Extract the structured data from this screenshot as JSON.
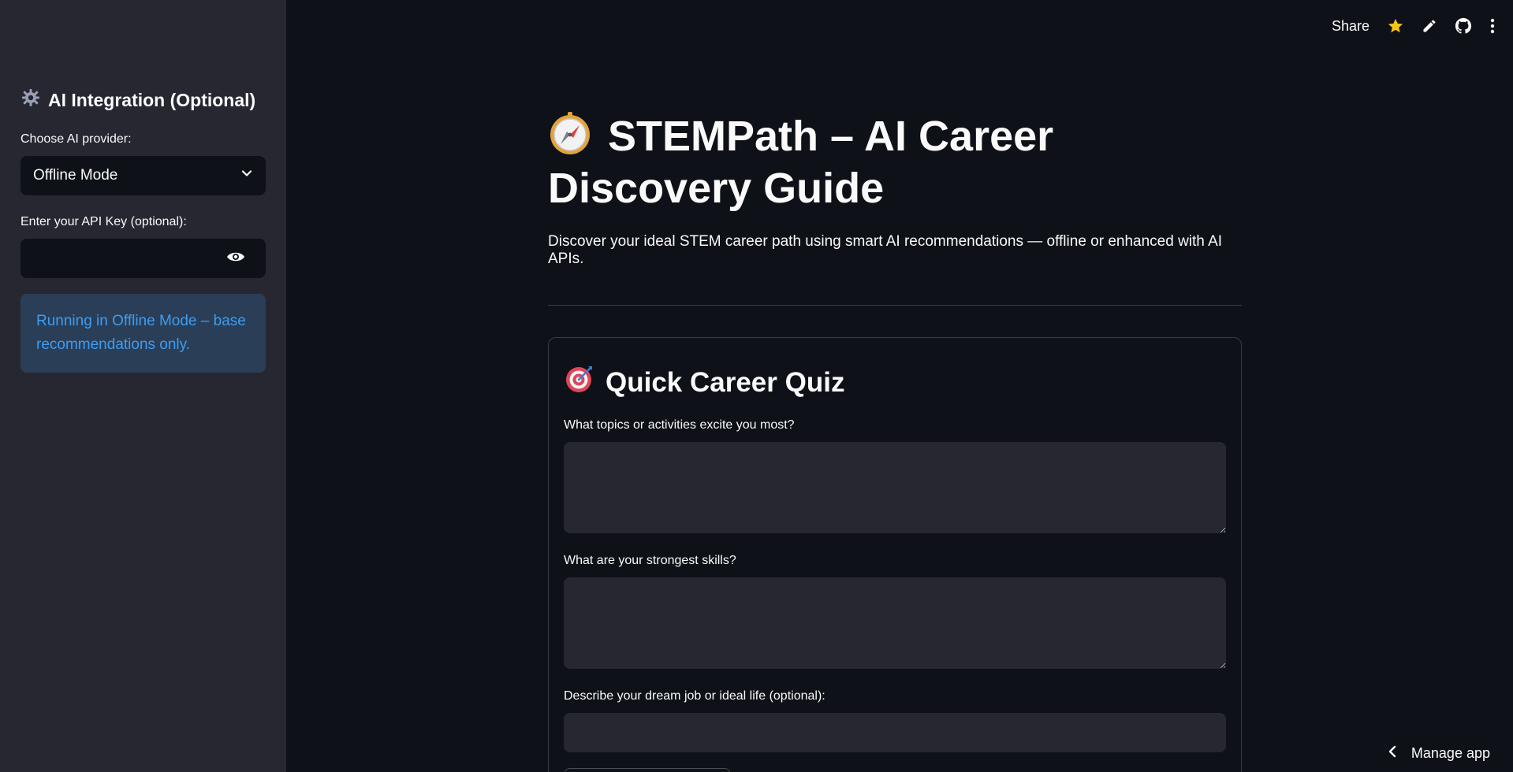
{
  "toolbar": {
    "share_label": "Share",
    "icons": [
      "star-icon",
      "edit-icon",
      "github-icon",
      "more-vert-icon"
    ],
    "star_color": "#f5c518"
  },
  "sidebar": {
    "title": "AI Integration (Optional)",
    "title_icon": "gear-icon",
    "provider_label": "Choose AI provider:",
    "provider_value": "Offline Mode",
    "api_key_label": "Enter your API Key (optional):",
    "api_key_value": "",
    "info_text": "Running in Offline Mode – base recommendations only.",
    "info_color": "#3d9df3"
  },
  "main": {
    "title": "STEMPath – AI Career Discovery Guide",
    "title_icon": "compass-icon",
    "subtitle": "Discover your ideal STEM career path using smart AI recommendations — offline or enhanced with AI APIs."
  },
  "quiz": {
    "heading": "Quick Career Quiz",
    "heading_icon": "target-icon",
    "q1_label": "What topics or activities excite you most?",
    "q1_value": "",
    "q2_label": "What are your strongest skills?",
    "q2_value": "",
    "q3_label": "Describe your dream job or ideal life (optional):",
    "q3_value": ""
  },
  "footer": {
    "manage_app_label": "Manage app"
  }
}
